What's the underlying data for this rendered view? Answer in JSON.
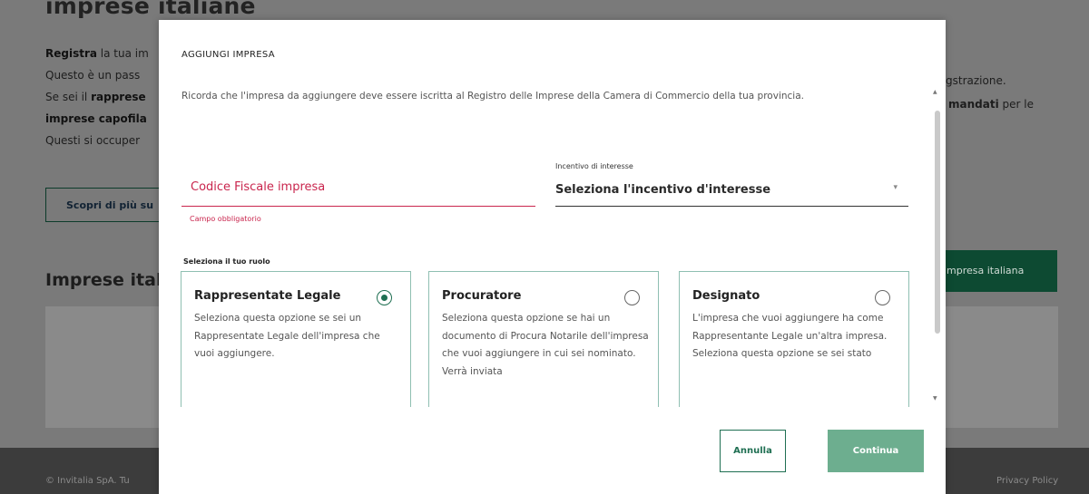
{
  "background": {
    "title": "imprese italiane",
    "lines": [
      {
        "bold": "Registra",
        "text": " la tua im"
      },
      {
        "text": "Questo è un pass"
      },
      {
        "text": "Se sei il ",
        "bold": "rapprese"
      },
      {
        "bold": "imprese capofila"
      },
      {
        "text": "Questi si occuper"
      }
    ],
    "right_text_1": "gstrazione.",
    "right_text_2_bold": "mandati",
    "right_text_2_tail": " per le",
    "outline_button": "Scopri di più su",
    "section_title": "Imprese itali",
    "green_button": "mpresa italiana",
    "footer_copyright": "© Invitalia SpA. Tu",
    "footer_privacy": "Privacy Policy"
  },
  "modal": {
    "title": "AGGIUNGI IMPRESA",
    "description": "Ricorda che l'impresa da aggiungere deve essere iscritta al Registro delle Imprese della Camera di Commercio della tua provincia.",
    "codice_fiscale": {
      "placeholder": "Codice Fiscale impresa",
      "value": "",
      "error": "Campo obbligatorio"
    },
    "incentivo": {
      "label": "Incentivo di interesse",
      "value": "Seleziona l'incentivo d'interesse",
      "arrow_icon": "caret-down-icon"
    },
    "role_label": "Seleziona il tuo ruolo",
    "roles": [
      {
        "title": "Rappresentate Legale",
        "text": "Seleziona questa opzione se sei un Rappresentate Legale dell'impresa che vuoi aggiungere.",
        "selected": true
      },
      {
        "title": "Procuratore",
        "text": "Seleziona questa opzione se hai un documento di Procura Notarile dell'impresa che vuoi aggiungere in cui sei nominato. Verrà inviata",
        "selected": false
      },
      {
        "title": "Designato",
        "text": "L'impresa che vuoi aggiungere ha come Rappresentante Legale un'altra impresa. Seleziona questa opzione se sei stato",
        "selected": false
      }
    ],
    "buttons": {
      "cancel": "Annulla",
      "confirm": "Continua"
    }
  },
  "colors": {
    "accent_green": "#1f6f52",
    "continue_green": "#6dae8f",
    "error_red": "#c9254d"
  }
}
